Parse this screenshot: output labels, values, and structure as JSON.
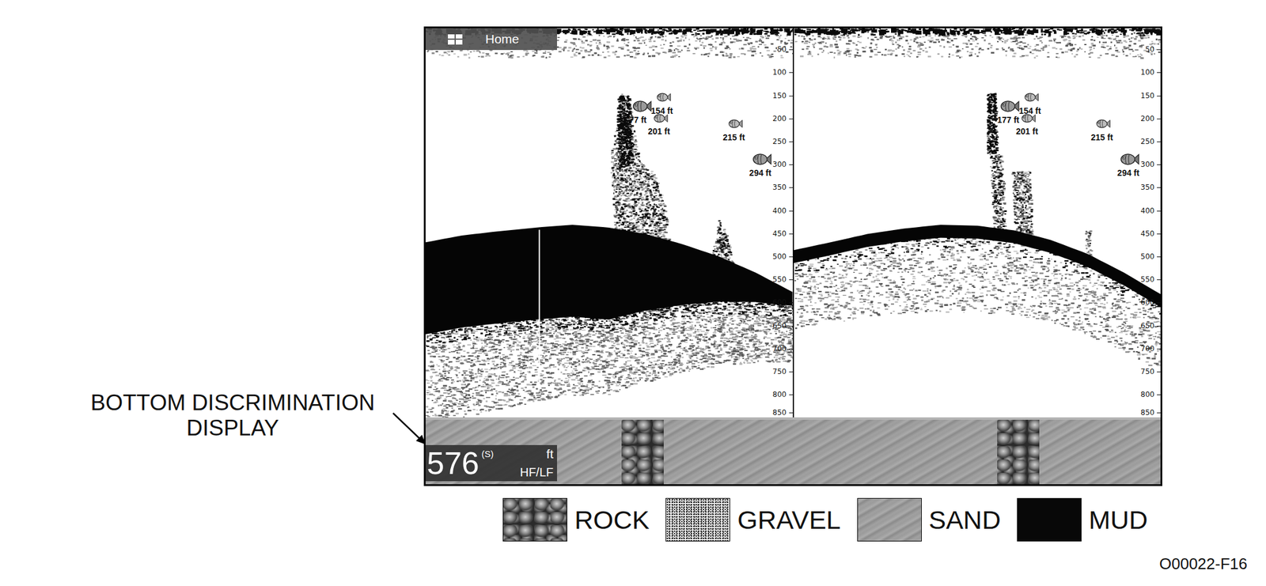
{
  "callout": {
    "lines": [
      "BOTTOM DISCRIMINATION",
      "DISPLAY"
    ]
  },
  "display": {
    "home_tab": {
      "label": "Home"
    },
    "depth_scale": [
      "50",
      "100",
      "150",
      "200",
      "250",
      "300",
      "350",
      "400",
      "450",
      "500",
      "550",
      "600",
      "650",
      "700",
      "750",
      "800",
      "850"
    ],
    "panels": [
      {
        "targets": [
          {
            "label": "154 ft",
            "depth": 154,
            "size": "small"
          },
          {
            "label": "77 ft",
            "depth": 174,
            "size": "large"
          },
          {
            "label": "201 ft",
            "depth": 199,
            "size": "small"
          },
          {
            "label": "215 ft",
            "depth": 212,
            "size": "small"
          },
          {
            "label": "294 ft",
            "depth": 289,
            "size": "large"
          }
        ],
        "bottom_profile": [
          469,
          454,
          445,
          437,
          431,
          437,
          451,
          473,
          500,
          535,
          577
        ]
      },
      {
        "targets": [
          {
            "label": "154 ft",
            "depth": 154,
            "size": "small"
          },
          {
            "label": "177 ft",
            "depth": 174,
            "size": "large"
          },
          {
            "label": "201 ft",
            "depth": 199,
            "size": "small"
          },
          {
            "label": "215 ft",
            "depth": 212,
            "size": "small"
          },
          {
            "label": "294 ft",
            "depth": 289,
            "size": "large"
          }
        ],
        "bottom_profile": [
          486,
          469,
          451,
          439,
          431,
          433,
          443,
          464,
          494,
          535,
          582
        ]
      }
    ],
    "bottom_strip": [
      {
        "kind": "sand",
        "share": 0.267
      },
      {
        "kind": "rock",
        "share": 0.057
      },
      {
        "kind": "sand",
        "share": 0.454
      },
      {
        "kind": "rock",
        "share": 0.057
      },
      {
        "kind": "sand",
        "share": 0.165
      }
    ],
    "depth_readout": {
      "value": "576",
      "mode": "(S)",
      "unit": "ft",
      "frequency": "HF/LF"
    }
  },
  "legend": [
    {
      "label": "ROCK",
      "kind": "rock"
    },
    {
      "label": "GRAVEL",
      "kind": "gravel"
    },
    {
      "label": "SAND",
      "kind": "sand"
    },
    {
      "label": "MUD",
      "kind": "mud"
    }
  ],
  "figure_id": "O00022-F16"
}
